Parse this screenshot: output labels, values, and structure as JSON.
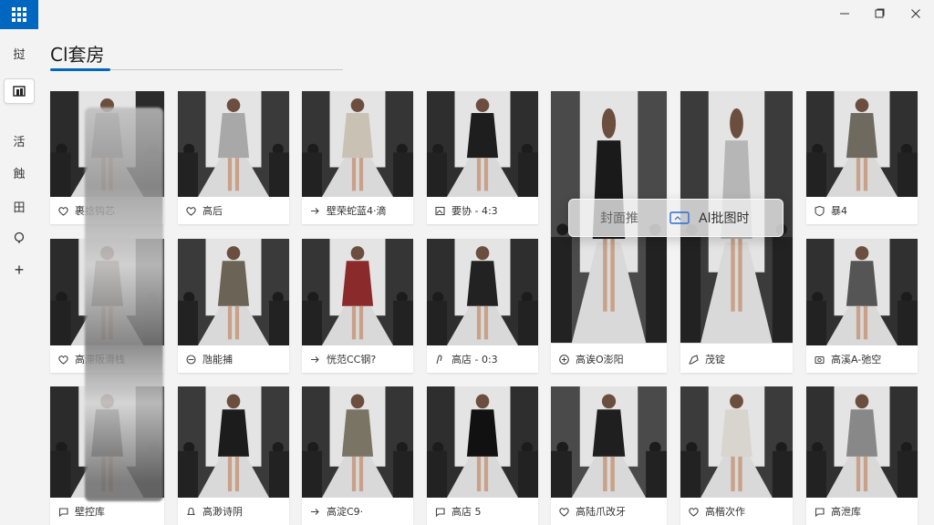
{
  "app": {
    "title": "Cl套房"
  },
  "rail": {
    "items": [
      {
        "label": "挝",
        "name": "rail-item-1"
      },
      {
        "label": "",
        "name": "rail-item-gallery"
      },
      {
        "label": "活",
        "name": "rail-item-3"
      },
      {
        "label": "蝕",
        "name": "rail-item-4"
      },
      {
        "label": "田",
        "name": "rail-item-5"
      },
      {
        "label": "",
        "name": "rail-item-6"
      },
      {
        "label": "+",
        "name": "rail-item-add"
      }
    ]
  },
  "floating_bar": {
    "left_label": "封面推",
    "right_label": "Al批图时"
  },
  "cards": [
    {
      "caption": "裹捻钩芯",
      "icon": "heart-icon"
    },
    {
      "caption": "高后",
      "icon": "heart-icon"
    },
    {
      "caption": "壁荣蛇蓝4·滴",
      "icon": "share-icon"
    },
    {
      "caption": "要协 - 4:3",
      "icon": "image-icon"
    },
    {
      "caption": "",
      "icon": ""
    },
    {
      "caption": "",
      "icon": ""
    },
    {
      "caption": "暴4",
      "icon": "shield-icon"
    },
    {
      "caption": "高滞阪滑栈",
      "icon": "heart-icon"
    },
    {
      "caption": "虺能捕",
      "icon": "link-icon"
    },
    {
      "caption": "恍范CC钢?",
      "icon": "share-icon"
    },
    {
      "caption": "高店 - 0:3",
      "icon": "note-icon"
    },
    {
      "caption": "高诶O澎阳",
      "icon": "add-circle-icon"
    },
    {
      "caption": "茂锭",
      "icon": "tag-icon"
    },
    {
      "caption": "高溪A-弛空",
      "icon": "camera-icon"
    },
    {
      "caption": "壁控库",
      "icon": "chat-icon"
    },
    {
      "caption": "高渺诗阴",
      "icon": "bell-icon"
    },
    {
      "caption": "高淀C9·",
      "icon": "share-icon"
    },
    {
      "caption": "高店 5",
      "icon": "chat-icon"
    },
    {
      "caption": "高陆爪改牙",
      "icon": "heart-icon"
    },
    {
      "caption": "高楷次作",
      "icon": "heart-icon"
    },
    {
      "caption": "高泄库",
      "icon": "chat-icon"
    }
  ]
}
